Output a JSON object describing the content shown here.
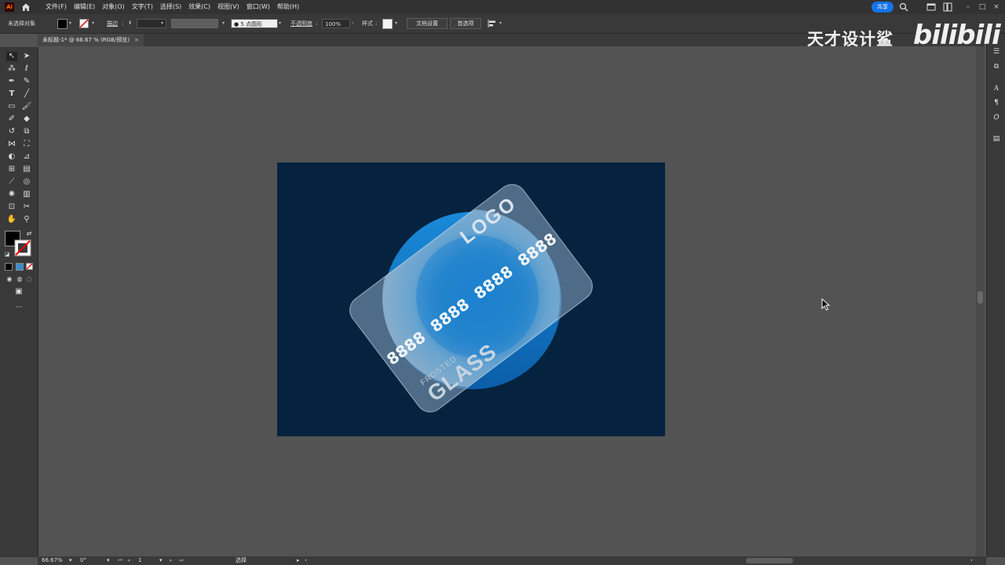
{
  "app": {
    "logo": "Ai"
  },
  "menu": [
    "文件(F)",
    "编辑(E)",
    "对象(O)",
    "文字(T)",
    "选择(S)",
    "效果(C)",
    "视图(V)",
    "窗口(W)",
    "帮助(H)"
  ],
  "top_right": {
    "share_label": "共享"
  },
  "controlbar": {
    "selection_state": "未选择对象",
    "stroke_label": "描边",
    "stroke_colon": ":",
    "brush_value": "5 点圆形",
    "opacity_label": "不透明度",
    "opacity_value": "100%",
    "style_label": "样式",
    "doc_setup_button": "文档设置",
    "preferences_button": "首选项"
  },
  "tab": {
    "title": "未标题-1* @ 66.67 % (RGB/预览)",
    "close": "×"
  },
  "statusbar": {
    "zoom": "66.67%",
    "rotation": "0°",
    "artboard_number": "1",
    "mode": "选择"
  },
  "artwork": {
    "logo_text": "LOGO",
    "card_number": "8888  8888  8888  8888",
    "frosted_text": "FROSTED",
    "glass_text": "GLASS",
    "background_color": "#05233f",
    "circle_color": "#1a8ad8"
  },
  "watermark": {
    "text": "天才设计鲨",
    "brand": "bilibili"
  }
}
